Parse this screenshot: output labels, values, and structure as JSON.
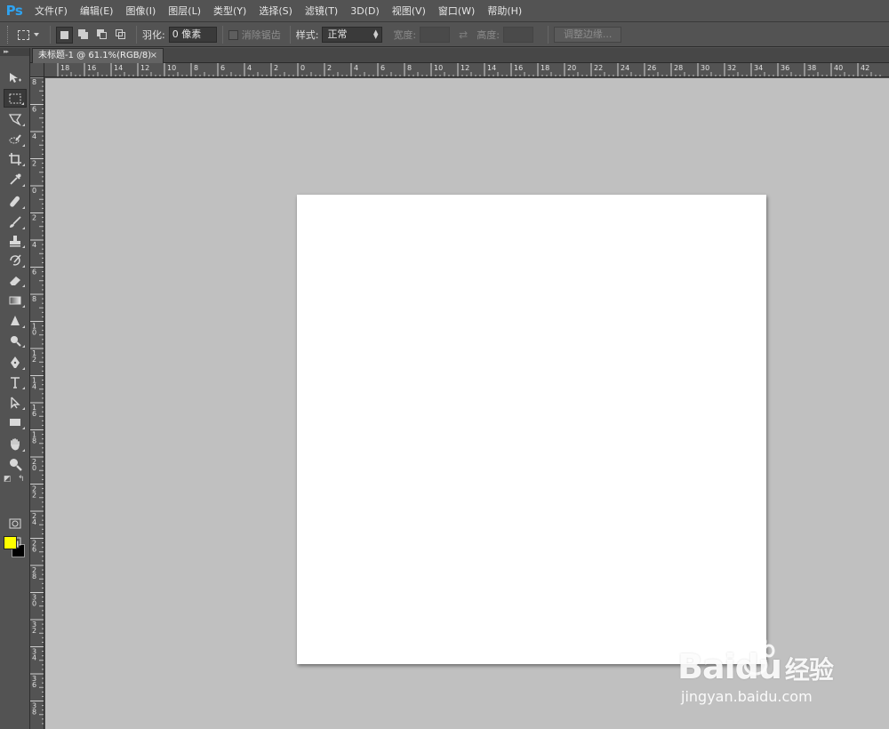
{
  "app": {
    "logo": "Ps"
  },
  "menu": [
    "文件(F)",
    "编辑(E)",
    "图像(I)",
    "图层(L)",
    "类型(Y)",
    "选择(S)",
    "滤镜(T)",
    "3D(D)",
    "视图(V)",
    "窗口(W)",
    "帮助(H)"
  ],
  "options": {
    "feather_label": "羽化:",
    "feather_value": "0 像素",
    "antialias_label": "消除锯齿",
    "style_label": "样式:",
    "style_value": "正常",
    "width_label": "宽度:",
    "height_label": "高度:",
    "refine_edge_label": "调整边缘..."
  },
  "document": {
    "tab_title": "未标题-1 @ 61.1%(RGB/8)",
    "close_glyph": "×"
  },
  "rulers": {
    "horizontal_labels": [
      "18",
      "16",
      "14",
      "12",
      "10",
      "8",
      "6",
      "4",
      "2",
      "0",
      "2",
      "4",
      "6",
      "8",
      "10",
      "12",
      "14",
      "16",
      "18",
      "20",
      "22",
      "24",
      "26",
      "28",
      "30",
      "32",
      "34",
      "36",
      "38",
      "40",
      "42"
    ],
    "vertical_labels": [
      "8",
      "6",
      "4",
      "2",
      "0",
      "2",
      "4",
      "6",
      "8",
      "10",
      "12",
      "14",
      "16",
      "18",
      "20",
      "22",
      "24",
      "26",
      "28",
      "30",
      "32",
      "34",
      "36",
      "38"
    ]
  },
  "tools": [
    "move-tool",
    "rectangular-marquee-tool",
    "lasso-tool",
    "quick-selection-tool",
    "crop-tool",
    "eyedropper-tool",
    "spot-healing-tool",
    "brush-tool",
    "clone-stamp-tool",
    "history-brush-tool",
    "eraser-tool",
    "gradient-tool",
    "blur-tool",
    "dodge-tool",
    "pen-tool",
    "type-tool",
    "path-selection-tool",
    "rectangle-tool",
    "hand-tool",
    "zoom-tool"
  ],
  "colors": {
    "foreground": "#ffff00",
    "background": "#000000",
    "workspace": "#c0c0c0",
    "canvas": "#ffffff",
    "logo": "#2fa3f0"
  },
  "watermark": {
    "brand": "Bai",
    "brand_suffix": "du",
    "brand_cn": "经验",
    "url": "jingyan.baidu.com"
  }
}
